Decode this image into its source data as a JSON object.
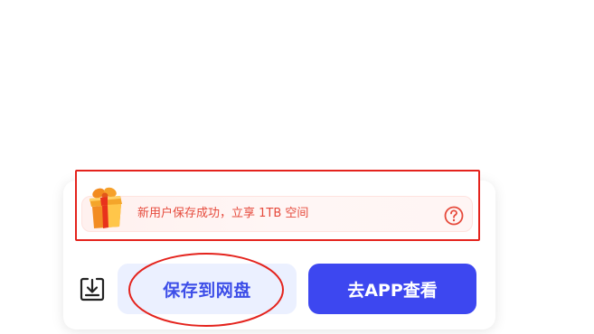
{
  "promo": {
    "text": "新用户保存成功，立享 1TB 空间",
    "gift_icon": "gift-box-icon",
    "help_icon": "question-circle-icon",
    "accent_color": "#e64a3c"
  },
  "actions": {
    "download_icon": "download-tray-icon",
    "save_label": "保存到网盘",
    "open_app_label": "去APP查看",
    "primary_color": "#3d47f0",
    "secondary_bg": "#ebf0ff"
  },
  "annotations": {
    "highlight_color": "#e4231d"
  }
}
